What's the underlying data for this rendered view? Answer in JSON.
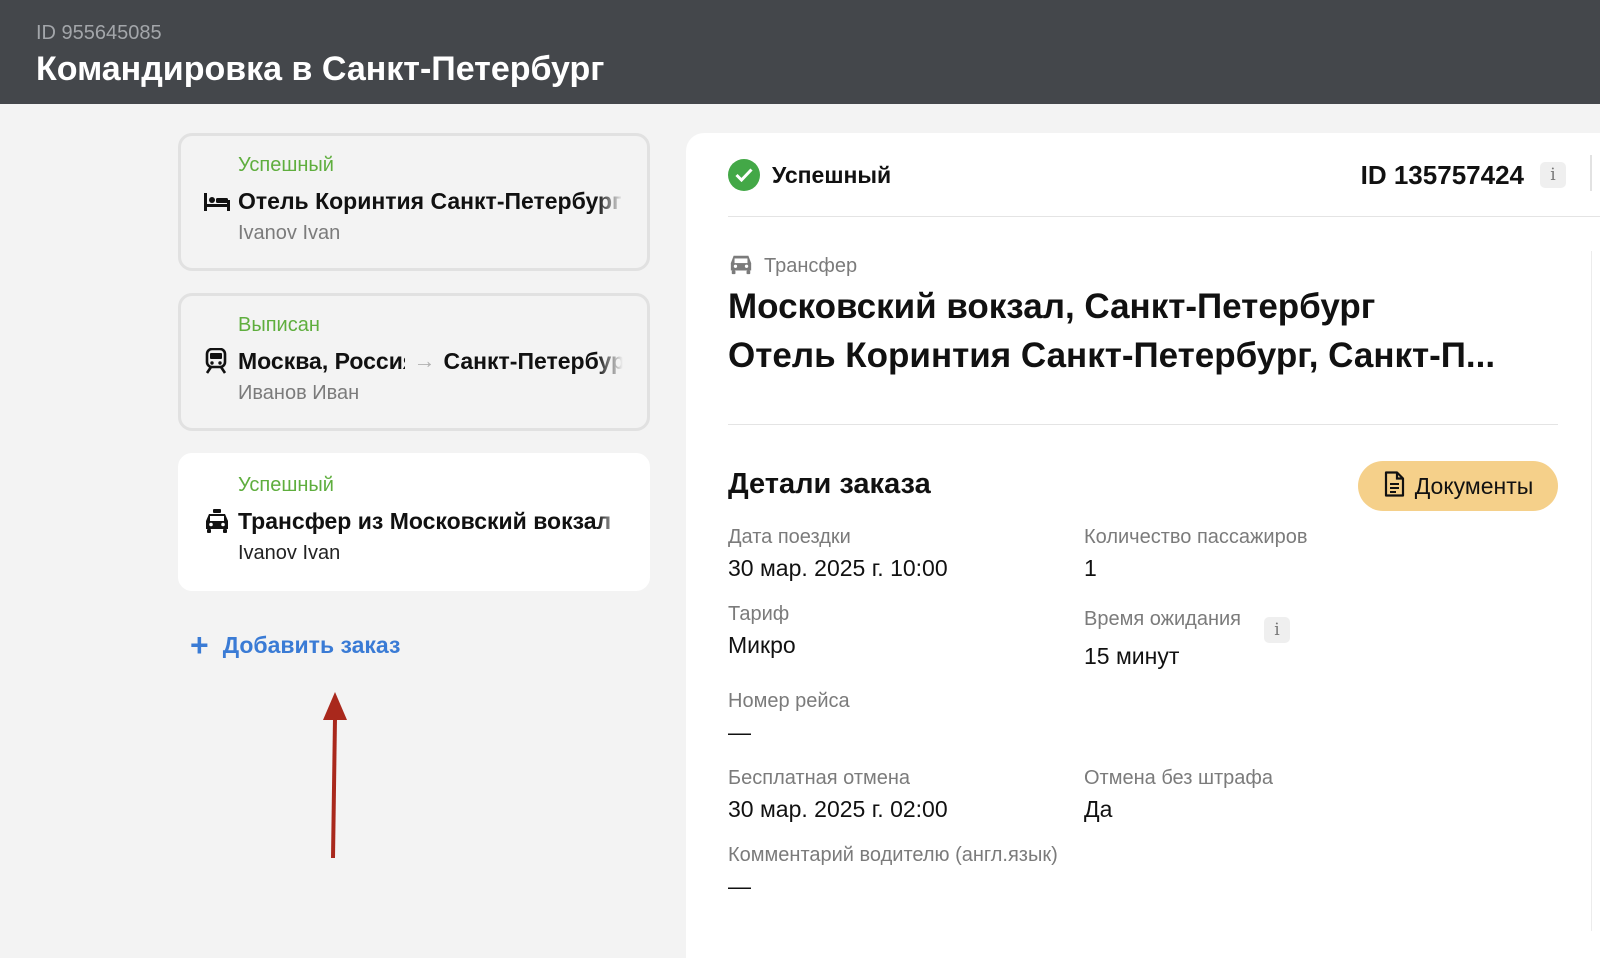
{
  "trip": {
    "id_text": "ID 955645085",
    "title": "Командировка в Санкт-Петербург"
  },
  "orders": [
    {
      "status": "Успешный",
      "icon": "hotel-bed-icon",
      "title": "Отель Коринтия Санкт-Петербург",
      "person": "Ivanov Ivan"
    },
    {
      "status": "Выписан",
      "icon": "train-icon",
      "from": "Москва, Россия",
      "to": "Санкт-Петербург",
      "person": "Иванов Иван"
    },
    {
      "status": "Успешный",
      "icon": "taxi-icon",
      "title": "Трансфер из Московский вокзал",
      "person": "Ivanov Ivan"
    }
  ],
  "add_order": {
    "label": "Добавить заказ"
  },
  "colors": {
    "header_bg": "#44474b",
    "status_green": "#5fae3e",
    "link_blue": "#3a7bd5",
    "docs_btn": "#f5d08a",
    "annotation_arrow": "#a9281c"
  },
  "detail": {
    "status": "Успешный",
    "order_id": "ID 135757424",
    "info_glyph": "i",
    "service_type": "Трансфер",
    "route_line_1": "Московский вокзал, Санкт-Петербург",
    "route_line_2": "Отель Коринтия Санкт-Петербург, Санкт-П...",
    "details_title": "Детали заказа",
    "documents_button": "Документы",
    "fields": {
      "trip_date": {
        "label": "Дата поездки",
        "value": "30 мар. 2025 г. 10:00"
      },
      "passengers": {
        "label": "Количество пассажиров",
        "value": "1"
      },
      "tariff": {
        "label": "Тариф",
        "value": "Микро"
      },
      "waiting_time": {
        "label": "Время ожидания",
        "value": "15 минут"
      },
      "flight_number": {
        "label": "Номер рейса",
        "value": "—"
      },
      "free_cancel": {
        "label": "Бесплатная отмена",
        "value": "30 мар. 2025 г. 02:00"
      },
      "no_penalty_cancel": {
        "label": "Отмена без штрафа",
        "value": "Да"
      },
      "driver_comment": {
        "label": "Комментарий водителю (англ.язык)",
        "value": "—"
      }
    }
  }
}
